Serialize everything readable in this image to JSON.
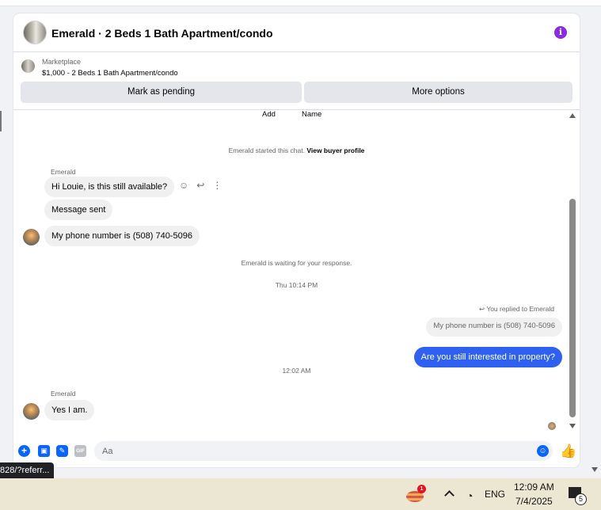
{
  "header": {
    "title": "Emerald · 2 Beds 1 Bath Apartment/condo",
    "info_icon": "info-icon"
  },
  "marketplace": {
    "label": "Marketplace",
    "listing": "$1,000 - 2 Beds 1 Bath Apartment/condo"
  },
  "actions": {
    "pending_label": "Mark as pending",
    "more_label": "More options"
  },
  "chat": {
    "partial_add": "Add",
    "partial_name": "Name",
    "started_text": "Emerald started this chat.",
    "view_profile": "View buyer profile",
    "sender_name": "Emerald",
    "msg1": "Hi Louie, is this still available?",
    "msg2": "Message sent",
    "msg3": "My phone number is (508) 740-5096",
    "waiting_text": "Emerald is waiting for your response.",
    "time1": "Thu 10:14 PM",
    "reply_note": "You replied to Emerald",
    "quoted": "My phone number is (508) 740-5096",
    "out_msg": "Are you still interested in property?",
    "time2": "12:02 AM",
    "sender_name2": "Emerald",
    "msg4": "Yes I am.",
    "accent_color": "#2e61f0"
  },
  "composer": {
    "placeholder": "Aa",
    "gif_label": "GIF"
  },
  "status_url": "828/?referr...",
  "taskbar": {
    "badge_count": "1",
    "lang": "ENG",
    "time": "12:09 AM",
    "date": "7/4/2025",
    "notif_count": "5"
  }
}
